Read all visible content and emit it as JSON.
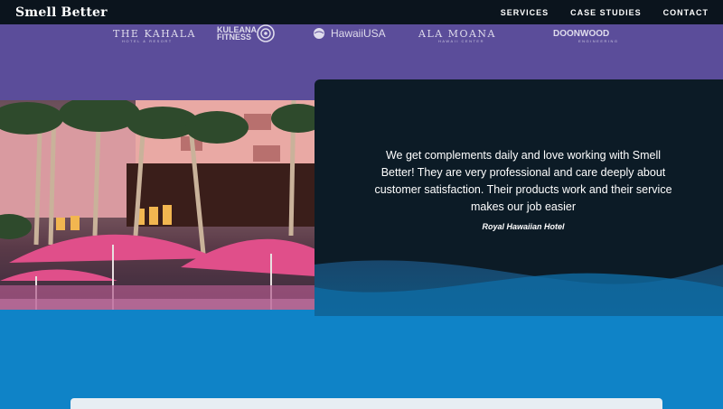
{
  "nav": {
    "brand": "Smell Better",
    "links": [
      "SERVICES",
      "CASE STUDIES",
      "CONTACT"
    ]
  },
  "logos": [
    {
      "name": "The Kahala",
      "text": "THE KAHALA",
      "sub": "HOTEL & RESORT"
    },
    {
      "name": "Kuleana Fitness",
      "text": "KULEANA FITNESS"
    },
    {
      "name": "HawaiiUSA",
      "text": "HawaiiUSA"
    },
    {
      "name": "Ala Moana",
      "text": "ALA MOANA",
      "sub": "HAWAII CENTER"
    },
    {
      "name": "Doonwood",
      "text": "DOONWOOD",
      "sub": "ENGINEERING"
    }
  ],
  "testimonial": {
    "quote": "We get complements daily and love working with Smell Better! They are very professional and care deeply about customer satisfaction. Their products work and their service makes our job easier",
    "author": "Royal Hawaiian Hotel"
  },
  "colors": {
    "nav_bg": "#0b141d",
    "band": "#5b4d9a",
    "card": "#0c1b26",
    "ocean": "#0f83c7"
  }
}
